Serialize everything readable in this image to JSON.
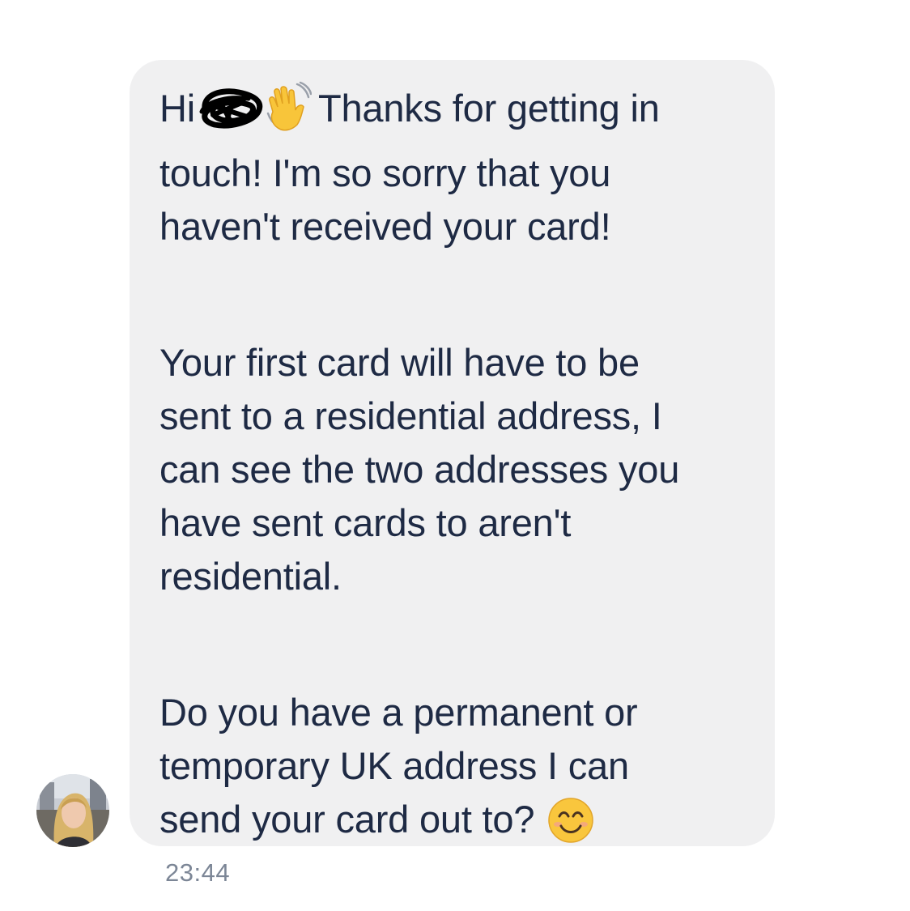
{
  "message": {
    "greeting": "Hi",
    "paragraph1": {
      "line1_after_emoji": "Thanks for getting in",
      "line2": "touch! I'm so sorry that you",
      "line3": "haven't received your card!"
    },
    "paragraph2": [
      "Your first card will have to be",
      "sent to a residential address, I",
      "can see the two addresses you",
      "have sent cards to aren't",
      "residential."
    ],
    "paragraph3": [
      "Do you have a permanent or",
      "temporary UK address I can",
      "send your card out to?"
    ],
    "emojis": {
      "wave": "waving-hand-emoji",
      "smile": "smiling-face-emoji"
    }
  },
  "timestamp": "23:44",
  "colors": {
    "bubble": "#f0f0f1",
    "text": "#1e2a44",
    "timestamp": "#7c8696"
  }
}
